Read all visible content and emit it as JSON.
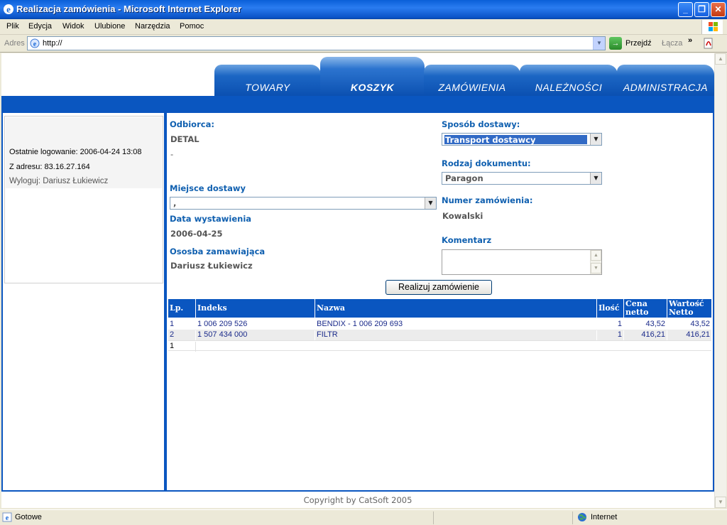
{
  "window": {
    "title": "Realizacja zamówienia - Microsoft Internet Explorer",
    "buttons": {
      "minimize": "_",
      "maximize": "❐",
      "close": "✕"
    }
  },
  "menu": {
    "items": [
      "Plik",
      "Edycja",
      "Widok",
      "Ulubione",
      "Narzędzia",
      "Pomoc"
    ]
  },
  "address": {
    "label": "Adres",
    "url": "http://",
    "go_label": "Przejdź",
    "links_label": "Łącza",
    "chevron": "»"
  },
  "tabs": [
    {
      "label": "TOWARY",
      "active": false
    },
    {
      "label": "KOSZYK",
      "active": true
    },
    {
      "label": "ZAMÓWIENIA",
      "active": false
    },
    {
      "label": "NALEŻNOŚCI",
      "active": false
    },
    {
      "label": "ADMINISTRACJA",
      "active": false
    }
  ],
  "session": {
    "last_login": "Ostatnie logowanie: 2006-04-24 13:08",
    "from_address": "Z adresu: 83.16.27.164",
    "logout": "Wyloguj: Dariusz Łukiewicz"
  },
  "form": {
    "recipient_label": "Odbiorca:",
    "recipient_value": "DETAL",
    "recipient_sub": "-",
    "delivery_place_label": "Miejsce dostawy",
    "delivery_place_value": ",",
    "issue_date_label": "Data wystawienia",
    "issue_date_value": "2006-04-25",
    "ordering_person_label": "Ososba zamawiająca",
    "ordering_person_value": "Dariusz Łukiewicz",
    "delivery_method_label": "Sposób dostawy:",
    "delivery_method_value": "Transport dostawcy",
    "document_type_label": "Rodzaj dokumentu:",
    "document_type_value": "Paragon",
    "order_number_label": "Numer zamówienia:",
    "order_number_value": "Kowalski",
    "comment_label": "Komentarz",
    "comment_value": "",
    "submit_label": "Realizuj zamówienie"
  },
  "table": {
    "headers": [
      "Lp.",
      "Indeks",
      "Nazwa",
      "Ilość",
      "Cena netto",
      "Wartość Netto"
    ],
    "rows": [
      [
        "1",
        "1 006 209 526",
        "BENDIX - 1 006 209 693",
        "1",
        "43,52",
        "43,52"
      ],
      [
        "2",
        "1 507 434 000",
        "FILTR",
        "1",
        "416,21",
        "416,21"
      ]
    ],
    "footer_count": "1"
  },
  "footer": {
    "copyright": "Copyright by CatSoft 2005"
  },
  "status": {
    "text": "Gotowe",
    "zone": "Internet"
  },
  "colors": {
    "brand_blue": "#0a56c0",
    "label_blue": "#1060b0",
    "row_alt": "#ececec"
  }
}
